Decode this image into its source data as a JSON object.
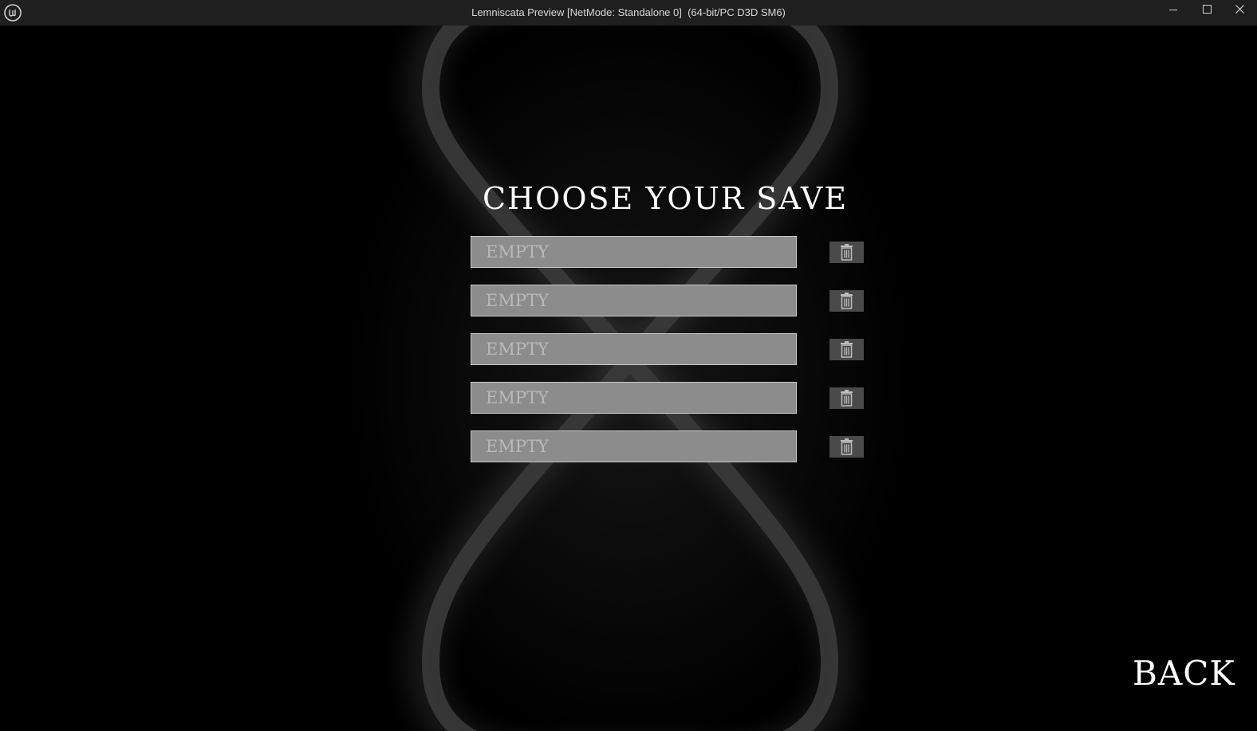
{
  "window": {
    "title": "Lemniscata Preview [NetMode: Standalone 0]  (64-bit/PC D3D SM6)",
    "logo_icon": "unreal-engine-logo-icon",
    "controls": [
      "minimize-icon",
      "maximize-icon",
      "close-icon"
    ]
  },
  "screen": {
    "heading": "CHOOSE YOUR SAVE",
    "slots": [
      {
        "label": "EMPTY",
        "delete_icon": "trash-icon"
      },
      {
        "label": "EMPTY",
        "delete_icon": "trash-icon"
      },
      {
        "label": "EMPTY",
        "delete_icon": "trash-icon"
      },
      {
        "label": "EMPTY",
        "delete_icon": "trash-icon"
      },
      {
        "label": "EMPTY",
        "delete_icon": "trash-icon"
      }
    ],
    "back_label": "BACK"
  },
  "colors": {
    "background": "#000000",
    "titlebar": "#1f1f1f",
    "slot_fill": "#8c8c8c",
    "slot_text": "#b9b9b9",
    "trash_button": "#4a4a4a",
    "lemniscate_glow": "#3a3a3a"
  }
}
